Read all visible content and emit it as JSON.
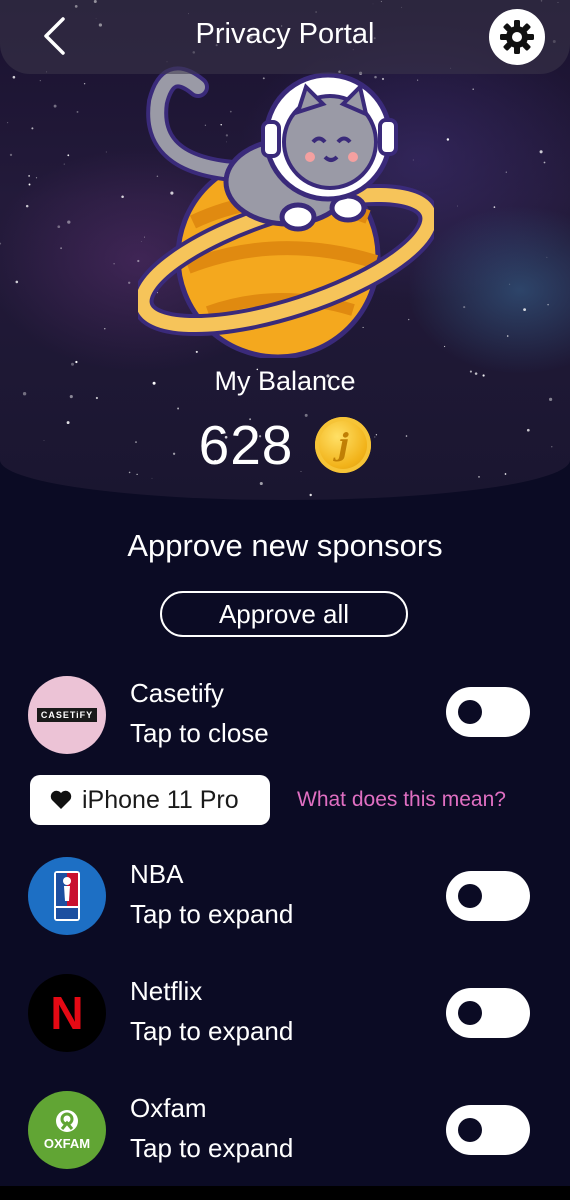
{
  "header": {
    "title": "Privacy Portal",
    "back_icon": "chevron-left-icon",
    "settings_icon": "gear-icon"
  },
  "balance": {
    "label": "My Balance",
    "value": "628",
    "coin_glyph": "j"
  },
  "sponsors_section": {
    "title": "Approve new sponsors",
    "approve_all_label": "Approve all"
  },
  "sponsors": [
    {
      "name": "Casetify",
      "subtitle": "Tap to close",
      "logo_text": "CASETiFY",
      "logo_bg": "#ecc3d6",
      "enabled": false
    },
    {
      "name": "NBA",
      "subtitle": "Tap to expand",
      "logo_text": "NBA",
      "logo_bg": "#1d6fc4",
      "enabled": false
    },
    {
      "name": "Netflix",
      "subtitle": "Tap to expand",
      "logo_text": "N",
      "logo_bg": "#000000",
      "enabled": false
    },
    {
      "name": "Oxfam",
      "subtitle": "Tap to expand",
      "logo_text": "OXFAM",
      "logo_bg": "#61a534",
      "enabled": false
    }
  ],
  "expanded_detail": {
    "chip_icon": "heart-icon",
    "chip_label": "iPhone 11 Pro",
    "help_link": "What does this mean?"
  },
  "colors": {
    "background": "#0b0b24",
    "accent_link": "#e06fc2",
    "coin": "#f2b31a"
  }
}
